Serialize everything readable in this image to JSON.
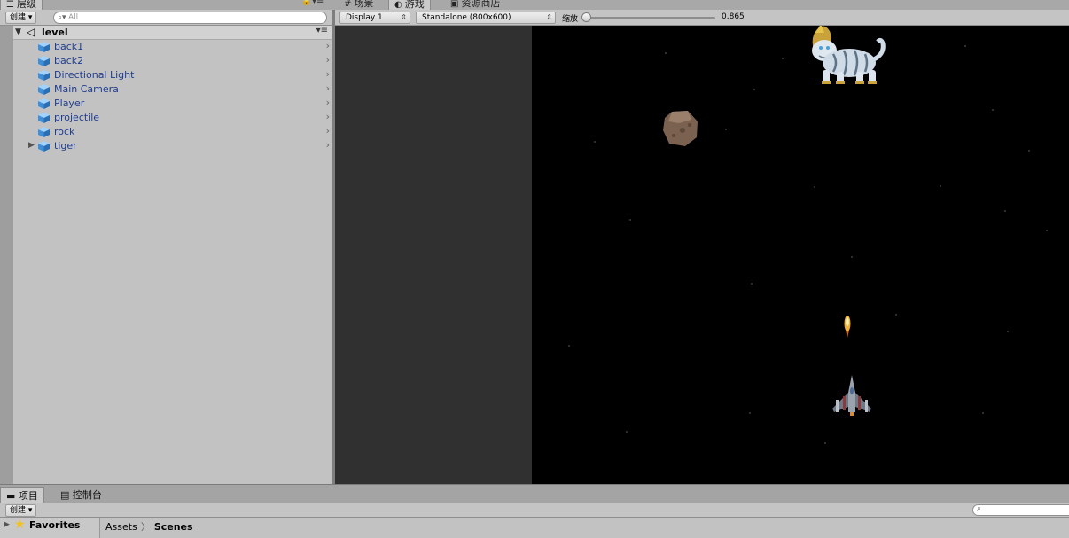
{
  "tabs": {
    "hierarchy": "层级",
    "scene": "场景",
    "game": "游戏",
    "store": "资源商店"
  },
  "hierarchy": {
    "create_label": "创建",
    "search_placeholder": "All",
    "scene_name": "level",
    "items": [
      {
        "label": "back1"
      },
      {
        "label": "back2"
      },
      {
        "label": "Directional Light"
      },
      {
        "label": "Main Camera"
      },
      {
        "label": "Player"
      },
      {
        "label": "projectile"
      },
      {
        "label": "rock"
      },
      {
        "label": "tiger"
      }
    ]
  },
  "game": {
    "display": "Display 1",
    "resolution": "Standalone (800x600)",
    "scale_label": "缩放",
    "scale_value": "0.865",
    "scale_fraction": 0.0
  },
  "bottom": {
    "project_tab": "项目",
    "console_tab": "控制台",
    "create_label": "创建",
    "favorites": "Favorites",
    "breadcrumb": [
      "Assets",
      "Scenes"
    ]
  },
  "colors": {
    "hierarchy_item_text": "#1f3d8f",
    "game_background": "#000000",
    "unused_area": "#303030"
  }
}
